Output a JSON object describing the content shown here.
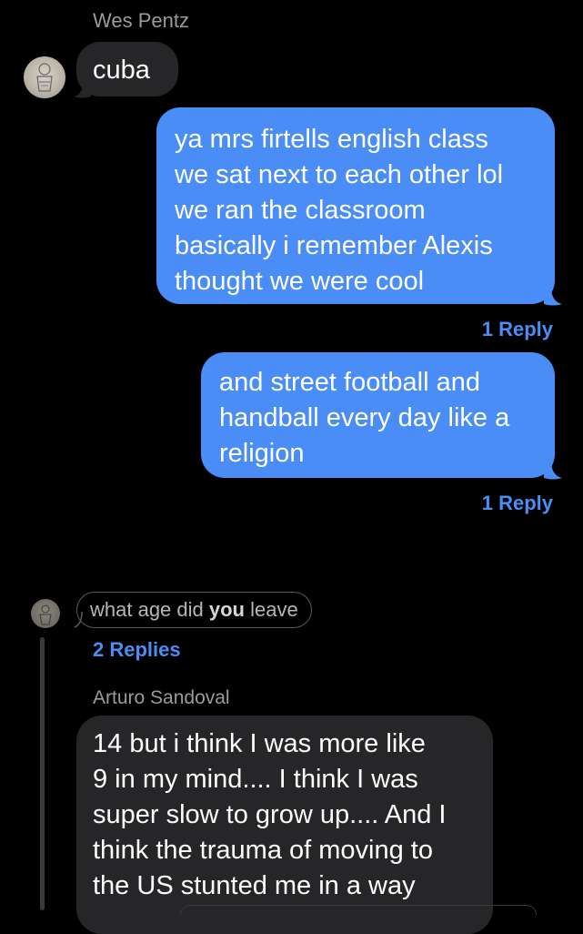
{
  "messages": [
    {
      "sender": "Wes Pentz",
      "text": "cuba"
    },
    {
      "text_lines": [
        "ya mrs firtells english class",
        "we sat next to each other lol",
        "we ran the classroom",
        "basically i remember Alexis",
        "thought we were cool"
      ],
      "replies": "1 Reply"
    },
    {
      "text_lines": [
        "and street football and",
        "handball every day like a",
        "religion"
      ],
      "replies": "1 Reply"
    }
  ],
  "thread": {
    "quoted_pre": "what age did ",
    "quoted_bold": "you",
    "quoted_post": " leave",
    "replies": "2 Replies",
    "reply_sender": "Arturo Sandoval",
    "reply_lines": [
      "14  but i think I was more like",
      "9 in my mind.... I think I was",
      "super slow to grow up.... And I",
      "think the trauma of moving to",
      "the US stunted me in a way"
    ]
  },
  "colors": {
    "background": "#000000",
    "incoming_bubble": "#262629",
    "outgoing_bubble": "#4a8df7",
    "link": "#4a8df7",
    "secondary_text": "#9a9a9f"
  }
}
